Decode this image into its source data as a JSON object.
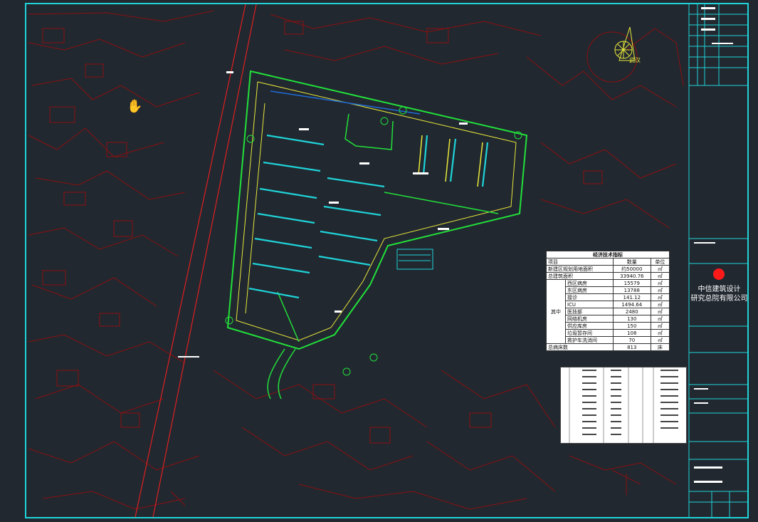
{
  "compass": {
    "label": "武汉"
  },
  "specs": {
    "title": "经济技术指标",
    "header": [
      "项目",
      "数量",
      "单位"
    ],
    "rows": [
      {
        "group": "",
        "name": "新建区规划用地面积",
        "value": "约50000",
        "unit": "㎡"
      },
      {
        "group": "",
        "name": "总建筑面积",
        "value": "33940.76",
        "unit": "㎡"
      },
      {
        "group": "其中",
        "name": "西区病房",
        "value": "15579",
        "unit": "㎡"
      },
      {
        "group": "",
        "name": "东区病房",
        "value": "13788",
        "unit": "㎡"
      },
      {
        "group": "",
        "name": "接诊",
        "value": "141.12",
        "unit": "㎡"
      },
      {
        "group": "",
        "name": "ICU",
        "value": "1494.64",
        "unit": "㎡"
      },
      {
        "group": "",
        "name": "医技部",
        "value": "2480",
        "unit": "㎡"
      },
      {
        "group": "",
        "name": "网络机房",
        "value": "130",
        "unit": "㎡"
      },
      {
        "group": "",
        "name": "供应库房",
        "value": "150",
        "unit": "㎡"
      },
      {
        "group": "",
        "name": "垃圾暂存间",
        "value": "108",
        "unit": "㎡"
      },
      {
        "group": "",
        "name": "救护车洗消间",
        "value": "70",
        "unit": "㎡"
      },
      {
        "group": "",
        "name": "总病床数",
        "value": "813",
        "unit": "床"
      }
    ]
  },
  "company": {
    "line1": "中信建筑设计",
    "line2": "研究总院有限公司"
  },
  "colors": {
    "background": "#212830",
    "frame": "#1fd3d8",
    "topo": "#8b1010",
    "site_green": "#22e03a",
    "road_yellow": "#e8e83a",
    "cyan": "#1fd3d8",
    "red_line": "#e02020"
  }
}
